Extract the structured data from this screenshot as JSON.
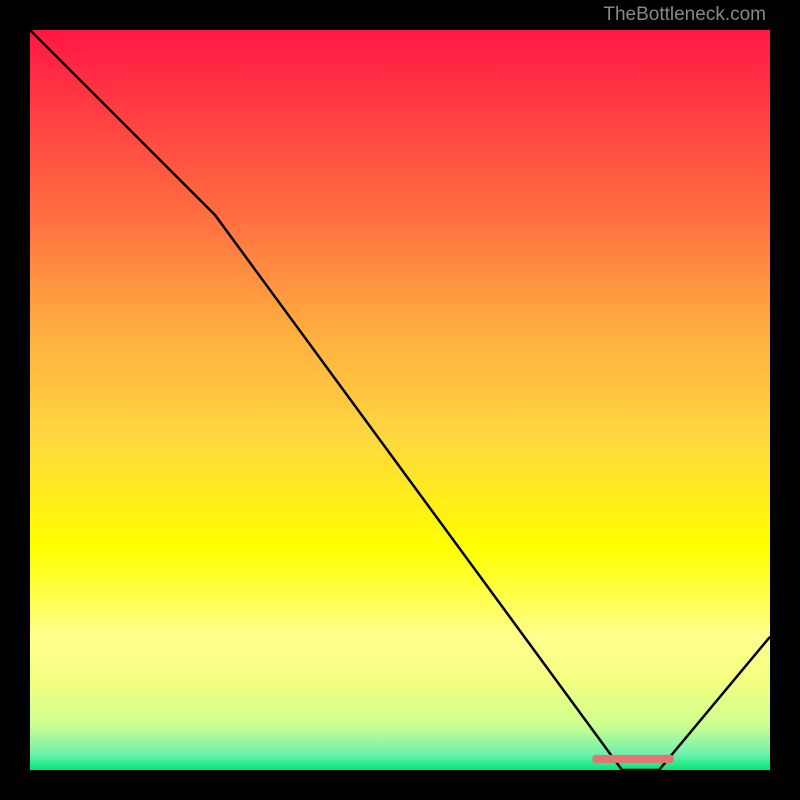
{
  "watermark": "TheBottleneck.com",
  "chart_data": {
    "type": "line",
    "title": "",
    "xlabel": "",
    "ylabel": "",
    "xlim": [
      0,
      100
    ],
    "ylim": [
      0,
      100
    ],
    "gradient_stops": [
      {
        "offset": 0,
        "color": "#ff1744"
      },
      {
        "offset": 25,
        "color": "#ff6e40"
      },
      {
        "offset": 40,
        "color": "#ffab40"
      },
      {
        "offset": 55,
        "color": "#ffd740"
      },
      {
        "offset": 70,
        "color": "#ffff00"
      },
      {
        "offset": 82,
        "color": "#ffff8d"
      },
      {
        "offset": 88,
        "color": "#f4ff81"
      },
      {
        "offset": 94,
        "color": "#ccff90"
      },
      {
        "offset": 98,
        "color": "#69f0ae"
      },
      {
        "offset": 100,
        "color": "#00e676"
      }
    ],
    "line_data": {
      "x": [
        0,
        18,
        25,
        80,
        85,
        100
      ],
      "y": [
        100,
        82,
        75,
        0,
        0,
        18
      ]
    },
    "marker": {
      "x_start": 76,
      "x_end": 87,
      "y": 1.5,
      "color": "#e57373"
    }
  }
}
